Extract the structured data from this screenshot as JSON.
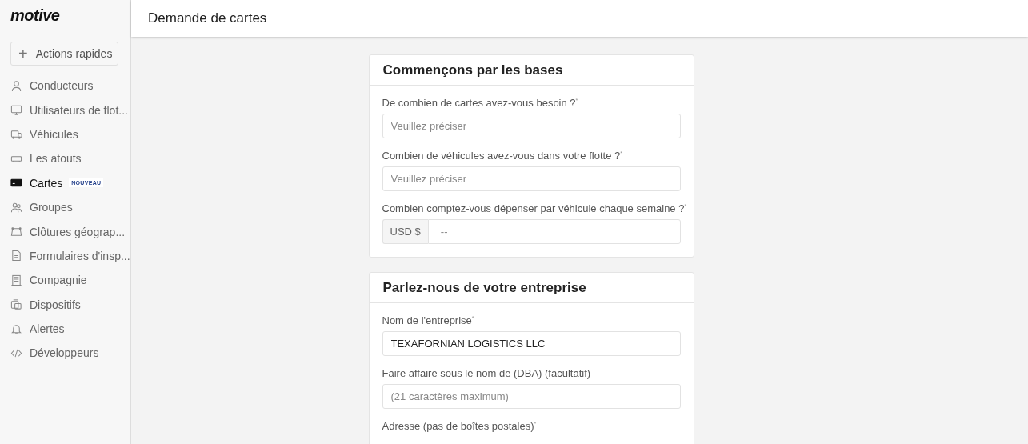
{
  "sidebar": {
    "logo": "motive",
    "quick_actions": {
      "icon": "+",
      "label": "Actions rapides"
    },
    "items": [
      {
        "label": "Conducteurs",
        "selected": false
      },
      {
        "label": "Utilisateurs de flot...",
        "selected": false
      },
      {
        "label": "Véhicules",
        "selected": false
      },
      {
        "label": "Les atouts",
        "selected": false
      },
      {
        "label": "Cartes",
        "selected": true,
        "badge": "NOUVEAU"
      },
      {
        "label": "Groupes",
        "selected": false
      },
      {
        "label": "Clôtures géograp...",
        "selected": false
      },
      {
        "label": "Formulaires d'insp...",
        "selected": false
      },
      {
        "label": "Compagnie",
        "selected": false
      },
      {
        "label": "Dispositifs",
        "selected": false
      },
      {
        "label": "Alertes",
        "selected": false
      },
      {
        "label": "Développeurs",
        "selected": false
      }
    ]
  },
  "header": {
    "title": "Demande de cartes"
  },
  "sections": [
    {
      "title": "Commençons par les bases",
      "fields": [
        {
          "label": "De combien de cartes avez-vous besoin ?$^{*}$",
          "placeholder": "Veuillez préciser"
        },
        {
          "label": "Combien de véhicules avez-vous dans votre flotte ?$^{*}$",
          "placeholder": "Veuillez préciser"
        },
        {
          "label": "Combien comptez-vous dépenser par véhicule chaque semaine ?$^{*}$",
          "prefix": "USD $",
          "placeholder": "--"
        }
      ]
    },
    {
      "title": "Parlez-nous de votre entreprise",
      "fields": [
        {
          "label": "Nom de l'entreprise$^{*}$",
          "value": "TEXAFORNIAN LOGISTICS LLC"
        },
        {
          "label": "Faire affaire sous le nom de (DBA) (facultatif)",
          "placeholder": "(21 caractères maximum)"
        },
        {
          "label": "Adresse (pas de boîtes postales)$^{*}$"
        }
      ]
    }
  ]
}
